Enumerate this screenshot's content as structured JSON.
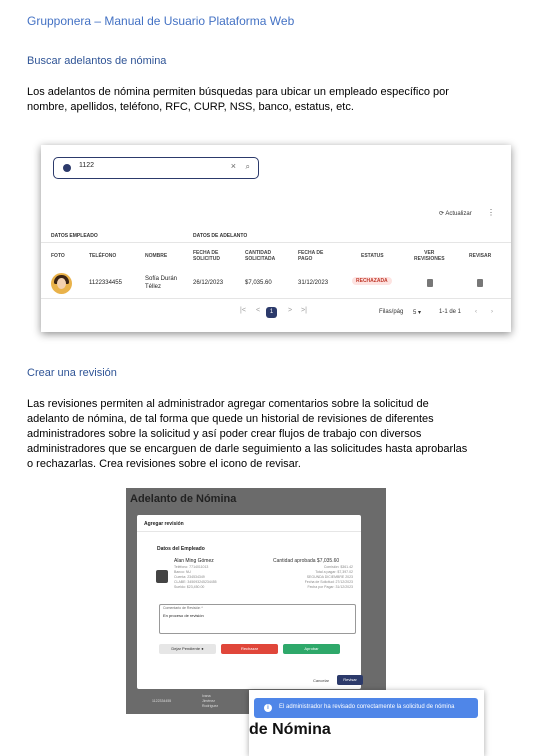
{
  "header_title": "Grupponera – Manual de Usuario Plataforma Web",
  "section1": {
    "heading": "Buscar adelantos de nómina",
    "paragraph_lines": [
      "Los adelantos de nómina permiten búsquedas para ubicar un empleado específico por",
      "nombre, apellidos, teléfono, RFC, CURP, NSS, banco, estatus, etc."
    ]
  },
  "shot1": {
    "search_value": "1122",
    "clear_icon": "close-icon",
    "search_icon": "search-icon",
    "actualizar": "Actualizar",
    "group_employee": "DATOS EMPLEADO",
    "group_advance": "DATOS DE ADELANTO",
    "columns": {
      "foto": "FOTO",
      "telefono": "TELÉFONO",
      "nombre": "NOMBRE",
      "fecha_solicitud": [
        "FECHA DE",
        "SOLICITUD"
      ],
      "cantidad": [
        "CANTIDAD",
        "SOLICITADA"
      ],
      "fecha_pago": [
        "FECHA DE",
        "PAGO"
      ],
      "estatus": "ESTATUS",
      "ver": [
        "VER",
        "REVISIONES"
      ],
      "revisar": "REVISAR"
    },
    "row": {
      "telefono": "1122334455",
      "nombre": [
        "Sofía Durán",
        "Téllez"
      ],
      "fecha_solicitud": "26/12/2023",
      "cantidad": "$7,035.60",
      "fecha_pago": "31/12/2023",
      "estatus": "RECHAZADA"
    },
    "pagination": {
      "first": "|<",
      "prev": "<",
      "current": "1",
      "next": ">",
      "last": ">|"
    },
    "filas_label": "Filas/pág",
    "filas_value": "5",
    "range": "1-1 de 1"
  },
  "section2": {
    "heading": "Crear una revisión",
    "paragraph_lines": [
      "Las revisiones permiten al administrador agregar comentarios sobre la solicitud de",
      "adelanto de nómina, de tal forma que quede un historial de revisiones de diferentes",
      "administradores sobre la solicitud y así poder crear flujos de trabajo con diversos",
      "administradores que se encarguen de darle seguimiento a las solicitudes hasta aprobarlas",
      "o rechazarlas. Crea revisiones sobre el icono de revisar."
    ]
  },
  "shot2": {
    "page_title": "Adelanto de Nómina",
    "modal_title": "Agregar revisión",
    "employee_section": "Datos del Empleado",
    "employee_name": "Alan Ming Gómez",
    "employee_details": [
      "Teléfono: 7714011013",
      "Banco: NU",
      "Cuenta: 234534349",
      "CLABE: 345093245234455",
      "Sueldo: $23,450.00"
    ],
    "approved": "Cantidad aprobada $7,035.60",
    "approved_details": [
      "Comisión: $361.42",
      "Total a pagar: $7,397.02",
      "SEGUNDA DICIEMBRE 2023",
      "Fecha de Solicitud: 27/12/2023",
      "Fecha por Pagar: 31/12/2023"
    ],
    "comment_label": "Comentario de Revisión *",
    "comment_value": "En proceso de revisión",
    "btn_pending": "Dejar Pendiente",
    "btn_reject": "Rechazar",
    "btn_approve": "Aprobar",
    "btn_cancel": "Cancelar",
    "btn_submit": "Revisar",
    "bg_row": [
      "1122334455",
      "Ivana",
      "Jiménez",
      "Rodríguez"
    ]
  },
  "toast": {
    "message": "El administrador ha revisado correctamente la solicitud de nómina",
    "behind_text": "de Nómina"
  },
  "colors": {
    "heading": "#2f5496",
    "primary": "#2c3a6b",
    "reject": "#e0463a",
    "approve": "#2ea86a",
    "toast": "#4f86e8"
  }
}
